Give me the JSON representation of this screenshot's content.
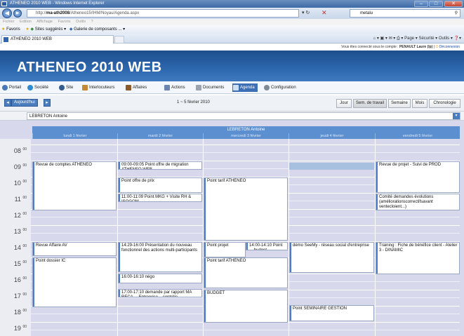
{
  "browser": {
    "window_title": "ATHENEO 2010 WEB - Windows Internet Explorer",
    "url_prefix": "http://",
    "url_host": "ma-ath2008",
    "url_path": "/Atheneo15/IHM/Noyau/Agenda.aspx",
    "search_text": "metalu",
    "menu": [
      "Fichier",
      "Edition",
      "Affichage",
      "Favoris",
      "Outils",
      "?"
    ],
    "favorites_label": "Favoris",
    "favorites_items": [
      "Sites suggérés ▾",
      "Galerie de composants ... ▾"
    ],
    "tab_title": "ATHENEO 2010 WEB",
    "tools": "Page ▾   Sécurité ▾   Outils ▾"
  },
  "app": {
    "logged_in_prefix": "Vous êtes connecté sous le compte :",
    "logged_in_user": "PENAULT Laure (lp)",
    "logout_label": "Déconnexion",
    "title": "ATHENEO 2010 WEB",
    "modules": [
      {
        "label": "Portail",
        "icon": "portal-icon"
      },
      {
        "label": "Société",
        "icon": "company-icon"
      },
      {
        "label": "Site",
        "icon": "site-icon"
      },
      {
        "label": "Interlocuteurs",
        "icon": "contacts-icon"
      },
      {
        "label": "Affaires",
        "icon": "deals-icon"
      },
      {
        "label": "Actions",
        "icon": "actions-icon"
      },
      {
        "label": "Documents",
        "icon": "documents-icon"
      },
      {
        "label": "Agenda",
        "icon": "calendar-icon"
      },
      {
        "label": "Configuration",
        "icon": "config-icon"
      }
    ],
    "active_module": "Agenda"
  },
  "agenda": {
    "today_label": "Aujourd'hui",
    "date_range": "1 ~ 5 février 2010",
    "views": [
      "Jour",
      "Sem. de travail",
      "Semaine",
      "Mois",
      "Chronologie"
    ],
    "active_view": "Sem. de travail",
    "selected_user": "LEBRETON Antoine",
    "user_header": "LEBRETON Antoine",
    "days": [
      "lundi 1 février",
      "mardi 2 février",
      "mercredi 3 février",
      "jeudi 4 février",
      "vendredi 5 février"
    ],
    "hours": [
      "08",
      "09",
      "10",
      "11",
      "12",
      "13",
      "14",
      "15",
      "16",
      "17",
      "18",
      "19"
    ],
    "minutes": "00",
    "events": [
      {
        "day": 0,
        "text": "Revue de comptes ATHENEO"
      },
      {
        "day": 0,
        "text": "Revue Affaire AV"
      },
      {
        "day": 0,
        "text": "Point dossier IC"
      },
      {
        "day": 1,
        "text": "09:00-09:05 Point offre de migration ATHENEO WEB"
      },
      {
        "day": 1,
        "text": "Point offre de prix"
      },
      {
        "day": 1,
        "text": "11:00-11:09 Point MKG + Visite RH & ISOGOM"
      },
      {
        "day": 1,
        "text": "14:29-16:00 Présentation du nouveau fonctionnel des actions multi-participants"
      },
      {
        "day": 1,
        "text": "16:00-16:10 négo"
      },
      {
        "day": 1,
        "text": "17:00-17:10 demande par rapport MA RECA ... Entreprise ...contrôle"
      },
      {
        "day": 2,
        "text": "Point tarif ATHENEO"
      },
      {
        "day": 2,
        "text": "Point projet"
      },
      {
        "day": 2,
        "text": "14:00-14:10 Point ... budget ..."
      },
      {
        "day": 2,
        "text": "Point tarif ATHENEO"
      },
      {
        "day": 2,
        "text": "BUDGET"
      },
      {
        "day": 3,
        "text": "démo SeeMy - réseau social d'entreprise"
      },
      {
        "day": 3,
        "text": "Point SEMINAIRE GESTION"
      },
      {
        "day": 4,
        "text": "Revue de projet - Suivi de PROD"
      },
      {
        "day": 4,
        "text": "Comité demandes évolutions (améliorationscorrectifsavant ventecloient...)"
      },
      {
        "day": 4,
        "text": "Training : Fiche de bénéfice client - Atelier 3 - DINAMIC"
      }
    ]
  }
}
